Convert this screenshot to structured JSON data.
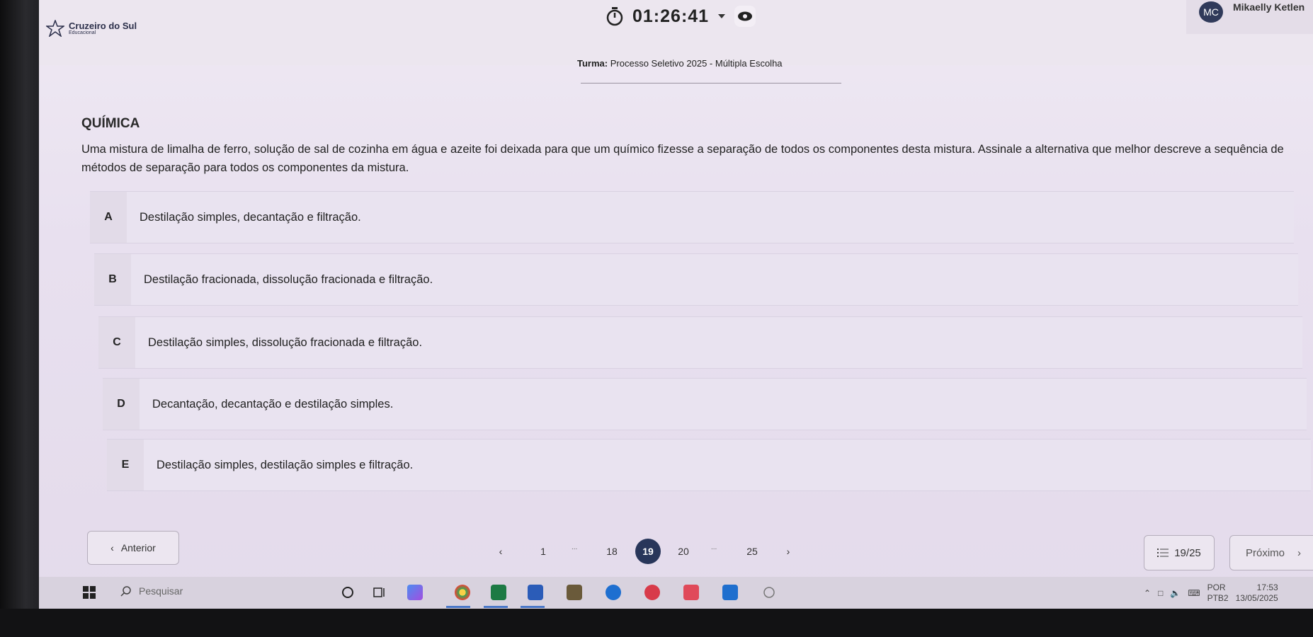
{
  "header": {
    "logo_name": "Cruzeiro do Sul",
    "logo_sub": "Educacional",
    "timer": "01:26:41",
    "user_initials": "MC",
    "user_name": "Mikaelly Ketlen"
  },
  "turma": {
    "label": "Turma:",
    "value": "Processo Seletivo 2025 - Múltipla Escolha"
  },
  "question": {
    "subject": "QUÍMICA",
    "text": "Uma mistura de limalha de ferro, solução de sal de cozinha em água e azeite foi deixada para que um químico fizesse a separação de todos os componentes desta mistura. Assinale a alternativa que melhor descreve a sequência de métodos de separação para todos os componentes da mistura.",
    "options": [
      {
        "letter": "A",
        "text": "Destilação simples, decantação e filtração."
      },
      {
        "letter": "B",
        "text": "Destilação fracionada, dissolução fracionada e filtração."
      },
      {
        "letter": "C",
        "text": "Destilação simples, dissolução fracionada e filtração."
      },
      {
        "letter": "D",
        "text": "Decantação, decantação e destilação simples."
      },
      {
        "letter": "E",
        "text": "Destilação simples, destilação simples e filtração."
      }
    ]
  },
  "pagination": {
    "prev_label": "Anterior",
    "next_label": "Próximo",
    "pages": [
      "1",
      "18",
      "19",
      "20",
      "25"
    ],
    "current": "19",
    "ellipsis": "...",
    "counter": "19/25"
  },
  "taskbar": {
    "search_placeholder": "Pesquisar",
    "lang_top": "POR",
    "lang_bottom": "PTB2",
    "time": "17:53",
    "date": "13/05/2025"
  },
  "colors": {
    "accent": "#28365a",
    "background": "#e8e0ef"
  }
}
